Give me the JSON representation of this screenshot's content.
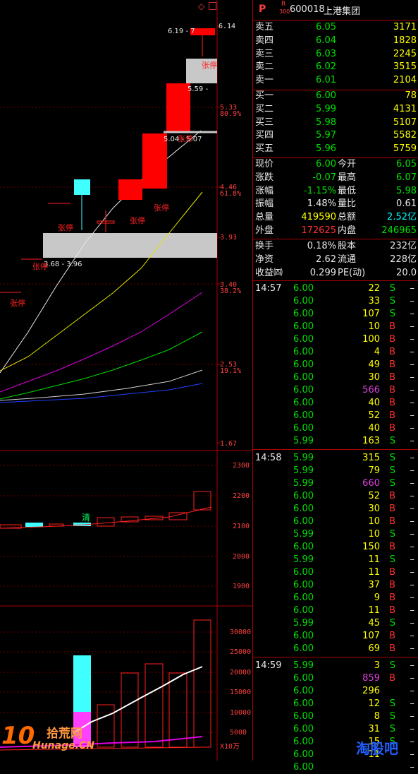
{
  "header": {
    "market_flag": "P",
    "r_label": "R",
    "r_sub": "300",
    "code": "600018",
    "name": "上港集团"
  },
  "chart_top": {
    "diamond": "◇",
    "box_icon": "□"
  },
  "price_axis": {
    "labels": [
      "6.14",
      "5.33",
      "80.9%",
      "4.46",
      "61.8%",
      "3.93",
      "3.40",
      "38.2%",
      "2.53",
      "19.1%",
      "1.67"
    ]
  },
  "volume_axis": {
    "labels": [
      "30000",
      "25000",
      "20000",
      "15000",
      "10000",
      "5000"
    ],
    "unit": "X10万"
  },
  "macd_axis": {
    "labels": [
      "2300",
      "2200",
      "2100",
      "2000",
      "1900"
    ]
  },
  "annotations": {
    "limit_up": "张停",
    "range_1": "6.19 - 7",
    "range_2": "5.59 -",
    "range_3": "5.04 - 5.07",
    "range_4": "3.68 - 3.96",
    "qing": "清"
  },
  "quotes": {
    "sell": [
      {
        "label": "卖五",
        "price": "6.05",
        "vol": "3171"
      },
      {
        "label": "卖四",
        "price": "6.04",
        "vol": "1828"
      },
      {
        "label": "卖三",
        "price": "6.03",
        "vol": "2245"
      },
      {
        "label": "卖二",
        "price": "6.02",
        "vol": "3515"
      },
      {
        "label": "卖一",
        "price": "6.01",
        "vol": "2104"
      }
    ],
    "buy": [
      {
        "label": "买一",
        "price": "6.00",
        "vol": "78"
      },
      {
        "label": "买二",
        "price": "5.99",
        "vol": "4131"
      },
      {
        "label": "买三",
        "price": "5.98",
        "vol": "5107"
      },
      {
        "label": "买四",
        "price": "5.97",
        "vol": "5582"
      },
      {
        "label": "买五",
        "price": "5.96",
        "vol": "5759"
      }
    ]
  },
  "stats": [
    {
      "l1": "现价",
      "v1": "6.00",
      "l2": "今开",
      "v2": "6.05",
      "c1": "#00e000",
      "c2": "#00e000"
    },
    {
      "l1": "涨跌",
      "v1": "-0.07",
      "l2": "最高",
      "v2": "6.07",
      "c1": "#00e000",
      "c2": "#00e000"
    },
    {
      "l1": "涨幅",
      "v1": "-1.15%",
      "l2": "最低",
      "v2": "5.98",
      "c1": "#00e000",
      "c2": "#00e000"
    },
    {
      "l1": "振幅",
      "v1": "1.48%",
      "l2": "量比",
      "v2": "0.61",
      "c1": "#e8e8e8",
      "c2": "#e8e8e8"
    },
    {
      "l1": "总量",
      "v1": "419590",
      "l2": "总额",
      "v2": "2.52亿",
      "c1": "#ffff00",
      "c2": "#00ffff"
    },
    {
      "l1": "外盘",
      "v1": "172625",
      "l2": "内盘",
      "v2": "246965",
      "c1": "#ff3030",
      "c2": "#00e000"
    }
  ],
  "stats2": [
    {
      "l1": "换手",
      "v1": "0.18%",
      "l2": "股本",
      "v2": "232亿"
    },
    {
      "l1": "净资",
      "v1": "2.62",
      "l2": "流通",
      "v2": "228亿"
    },
    {
      "l1": "收益㈣",
      "v1": "0.299",
      "l2": "PE(动)",
      "v2": "20.0"
    }
  ],
  "ticks": [
    {
      "t": "14:57",
      "p": "6.00",
      "v": "22",
      "s": "S",
      "pc": "#00e000",
      "vc": "#ffff00"
    },
    {
      "t": "",
      "p": "6.00",
      "v": "33",
      "s": "S",
      "pc": "#00e000",
      "vc": "#ffff00"
    },
    {
      "t": "",
      "p": "6.00",
      "v": "107",
      "s": "S",
      "pc": "#00e000",
      "vc": "#ffff00"
    },
    {
      "t": "",
      "p": "6.00",
      "v": "10",
      "s": "B",
      "pc": "#00e000",
      "vc": "#ffff00"
    },
    {
      "t": "",
      "p": "6.00",
      "v": "100",
      "s": "B",
      "pc": "#00e000",
      "vc": "#ffff00"
    },
    {
      "t": "",
      "p": "6.00",
      "v": "4",
      "s": "B",
      "pc": "#00e000",
      "vc": "#ffff00"
    },
    {
      "t": "",
      "p": "6.00",
      "v": "49",
      "s": "B",
      "pc": "#00e000",
      "vc": "#ffff00"
    },
    {
      "t": "",
      "p": "6.00",
      "v": "30",
      "s": "B",
      "pc": "#00e000",
      "vc": "#ffff00"
    },
    {
      "t": "",
      "p": "6.00",
      "v": "566",
      "s": "B",
      "pc": "#00e000",
      "vc": "#e040e0"
    },
    {
      "t": "",
      "p": "6.00",
      "v": "40",
      "s": "B",
      "pc": "#00e000",
      "vc": "#ffff00"
    },
    {
      "t": "",
      "p": "6.00",
      "v": "52",
      "s": "B",
      "pc": "#00e000",
      "vc": "#ffff00"
    },
    {
      "t": "",
      "p": "6.00",
      "v": "40",
      "s": "B",
      "pc": "#00e000",
      "vc": "#ffff00"
    },
    {
      "t": "",
      "p": "5.99",
      "v": "163",
      "s": "S",
      "pc": "#00e000",
      "vc": "#ffff00"
    },
    {
      "t": "14:58",
      "p": "5.99",
      "v": "315",
      "s": "S",
      "pc": "#00e000",
      "vc": "#ffff00"
    },
    {
      "t": "",
      "p": "5.99",
      "v": "79",
      "s": "S",
      "pc": "#00e000",
      "vc": "#ffff00"
    },
    {
      "t": "",
      "p": "5.99",
      "v": "660",
      "s": "S",
      "pc": "#00e000",
      "vc": "#e040e0"
    },
    {
      "t": "",
      "p": "6.00",
      "v": "52",
      "s": "B",
      "pc": "#00e000",
      "vc": "#ffff00"
    },
    {
      "t": "",
      "p": "6.00",
      "v": "30",
      "s": "B",
      "pc": "#00e000",
      "vc": "#ffff00"
    },
    {
      "t": "",
      "p": "6.00",
      "v": "10",
      "s": "B",
      "pc": "#00e000",
      "vc": "#ffff00"
    },
    {
      "t": "",
      "p": "5.99",
      "v": "10",
      "s": "S",
      "pc": "#00e000",
      "vc": "#ffff00"
    },
    {
      "t": "",
      "p": "6.00",
      "v": "150",
      "s": "B",
      "pc": "#00e000",
      "vc": "#ffff00"
    },
    {
      "t": "",
      "p": "5.99",
      "v": "11",
      "s": "S",
      "pc": "#00e000",
      "vc": "#ffff00"
    },
    {
      "t": "",
      "p": "6.00",
      "v": "11",
      "s": "B",
      "pc": "#00e000",
      "vc": "#ffff00"
    },
    {
      "t": "",
      "p": "6.00",
      "v": "37",
      "s": "B",
      "pc": "#00e000",
      "vc": "#ffff00"
    },
    {
      "t": "",
      "p": "6.00",
      "v": "9",
      "s": "B",
      "pc": "#00e000",
      "vc": "#ffff00"
    },
    {
      "t": "",
      "p": "6.00",
      "v": "11",
      "s": "B",
      "pc": "#00e000",
      "vc": "#ffff00"
    },
    {
      "t": "",
      "p": "5.99",
      "v": "45",
      "s": "S",
      "pc": "#00e000",
      "vc": "#ffff00"
    },
    {
      "t": "",
      "p": "6.00",
      "v": "107",
      "s": "B",
      "pc": "#00e000",
      "vc": "#ffff00"
    },
    {
      "t": "",
      "p": "6.00",
      "v": "69",
      "s": "B",
      "pc": "#00e000",
      "vc": "#ffff00"
    },
    {
      "t": "14:59",
      "p": "5.99",
      "v": "3",
      "s": "S",
      "pc": "#00e000",
      "vc": "#ffff00"
    },
    {
      "t": "",
      "p": "6.00",
      "v": "859",
      "s": "B",
      "pc": "#00e000",
      "vc": "#e040e0"
    },
    {
      "t": "",
      "p": "6.00",
      "v": "296",
      "s": "",
      "pc": "#00e000",
      "vc": "#ffff00"
    },
    {
      "t": "",
      "p": "6.00",
      "v": "12",
      "s": "S",
      "pc": "#00e000",
      "vc": "#ffff00"
    },
    {
      "t": "",
      "p": "6.00",
      "v": "8",
      "s": "S",
      "pc": "#00e000",
      "vc": "#ffff00"
    },
    {
      "t": "",
      "p": "6.00",
      "v": "31",
      "s": "S",
      "pc": "#00e000",
      "vc": "#ffff00"
    },
    {
      "t": "",
      "p": "6.00",
      "v": "15",
      "s": "S",
      "pc": "#00e000",
      "vc": "#ffff00"
    },
    {
      "t": "",
      "p": "6.00",
      "v": "11",
      "s": "",
      "pc": "#00e000",
      "vc": "#ffff00"
    },
    {
      "t": "",
      "p": "6.00",
      "v": "",
      "s": "",
      "pc": "#00e000",
      "vc": "#ffff00"
    }
  ],
  "watermark": {
    "left_num": "10",
    "left_text": "拾荒网",
    "left_url": "Hunage.CN",
    "right_text": "淘股吧"
  }
}
